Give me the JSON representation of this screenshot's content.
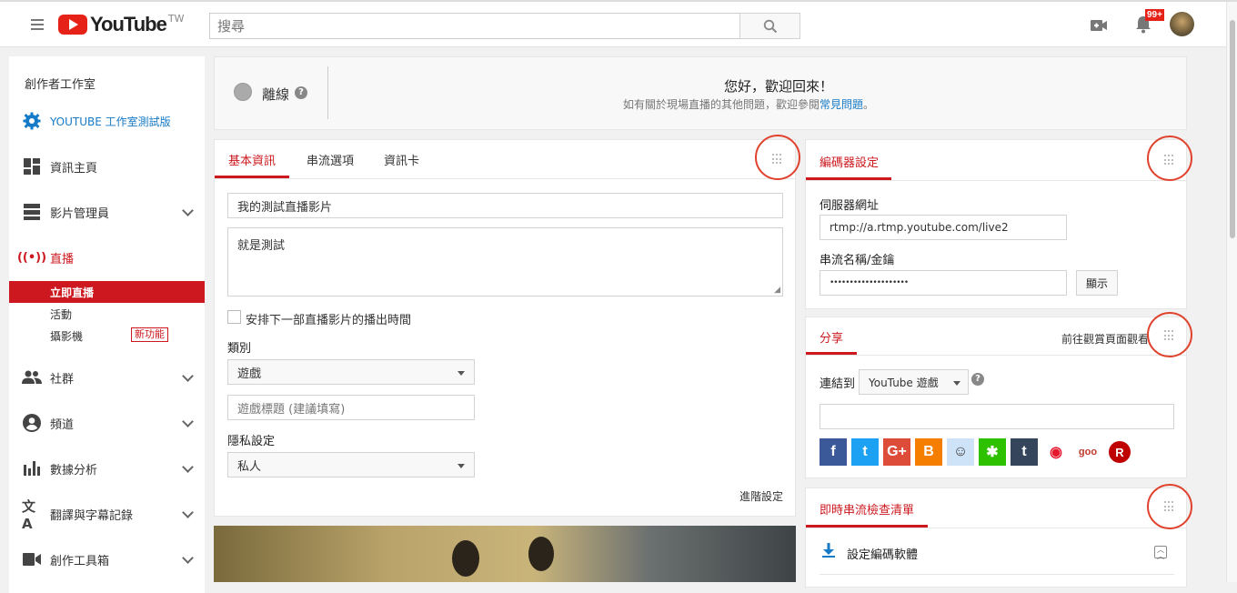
{
  "header": {
    "logo_text": "YouTube",
    "region": "TW",
    "search_placeholder": "搜尋",
    "notif_badge": "99+"
  },
  "sidebar": {
    "title": "創作者工作室",
    "studio_beta": "YOUTUBE 工作室測試版",
    "items": [
      {
        "label": "資訊主頁"
      },
      {
        "label": "影片管理員"
      },
      {
        "label": "直播"
      },
      {
        "label": "社群"
      },
      {
        "label": "頻道"
      },
      {
        "label": "數據分析"
      },
      {
        "label": "翻譯與字幕記錄"
      },
      {
        "label": "創作工具箱"
      }
    ],
    "live_sub": [
      {
        "label": "立即直播"
      },
      {
        "label": "活動"
      },
      {
        "label": "攝影機"
      }
    ],
    "new_badge": "新功能"
  },
  "status": {
    "state": "離線",
    "greeting": "您好，歡迎回來！",
    "faq_prefix": "如有關於現場直播的其他問題，歡迎參閱",
    "faq_link": "常見問題",
    "faq_suffix": "。"
  },
  "info": {
    "tabs": [
      "基本資訊",
      "串流選項",
      "資訊卡"
    ],
    "title_value": "我的測試直播影片",
    "description_value": "就是測試",
    "schedule_label": "安排下一部直播影片的播出時間",
    "category_label": "類別",
    "category_value": "遊戲",
    "game_title_placeholder": "遊戲標題 (建議填寫)",
    "privacy_label": "隱私設定",
    "privacy_value": "私人",
    "advanced_link": "進階設定"
  },
  "encoder": {
    "title": "編碼器設定",
    "server_label": "伺服器網址",
    "server_value": "rtmp://a.rtmp.youtube.com/live2",
    "key_label": "串流名稱/金鑰",
    "key_value": "••••••••••••••••••••",
    "show_button": "顯示"
  },
  "share": {
    "title": "分享",
    "watch_link": "前往觀賞頁面觀看",
    "connect_label": "連結到",
    "connect_value": "YouTube 遊戲",
    "social": [
      {
        "name": "facebook",
        "glyph": "f",
        "color": "#3b5998"
      },
      {
        "name": "twitter",
        "glyph": "t",
        "color": "#1da1f2"
      },
      {
        "name": "google-plus",
        "glyph": "G+",
        "color": "#dd4b39"
      },
      {
        "name": "blogger",
        "glyph": "B",
        "color": "#f57d00"
      },
      {
        "name": "reddit",
        "glyph": "☺",
        "color": "#cee3f8"
      },
      {
        "name": "wechat",
        "glyph": "✱",
        "color": "#2dc100"
      },
      {
        "name": "tumblr",
        "glyph": "t",
        "color": "#35465c"
      },
      {
        "name": "weibo",
        "glyph": "◉",
        "color": "#ffffff"
      },
      {
        "name": "goo",
        "glyph": "goo",
        "color": "#ffffff"
      },
      {
        "name": "rakuten",
        "glyph": "R",
        "color": "#bf0000"
      }
    ]
  },
  "checklist": {
    "title": "即時串流檢查清單",
    "item1": "設定編碼軟體"
  },
  "colors": {
    "accent": "#cc181e",
    "link": "#167ac6",
    "ring": "#e0422e"
  }
}
